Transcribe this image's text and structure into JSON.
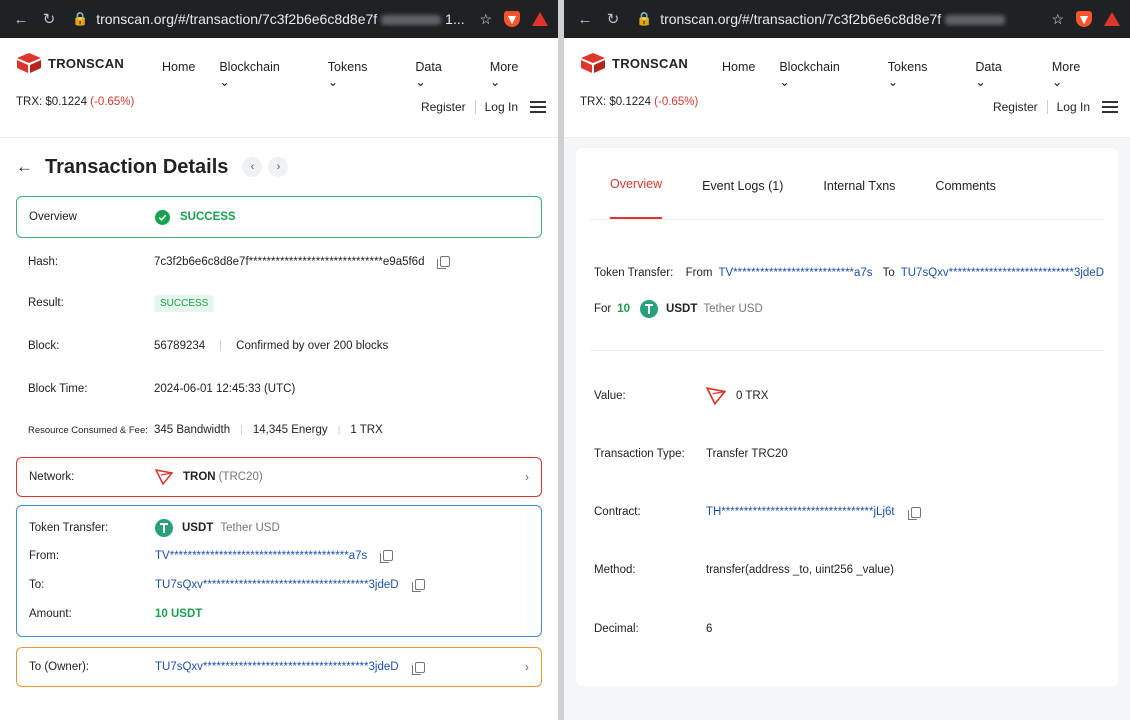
{
  "browser": {
    "url_text": "tronscan.org/#/transaction/7c3f2b6e6c8d8e7f",
    "url_suffix_left": "1..."
  },
  "site": {
    "logo_text": "TRONSCAN",
    "menu": [
      "Home",
      "Blockchain",
      "Tokens",
      "Data",
      "More"
    ],
    "price_label": "TRX: $0.1224",
    "price_change": "(-0.65%)",
    "register": "Register",
    "login": "Log In"
  },
  "left": {
    "title": "Transaction Details",
    "overview_label": "Overview",
    "overview_status": "SUCCESS",
    "hash_label": "Hash:",
    "hash_value": "7c3f2b6e6c8d8e7f******************************e9a5f6d",
    "result_label": "Result:",
    "result_value": "SUCCESS",
    "block_label": "Block:",
    "block_value": "56789234",
    "block_confirm": "Confirmed by over 200 blocks",
    "time_label": "Block Time:",
    "time_value": "2024-06-01 12:45:33 (UTC)",
    "resource_label": "Resource Consumed & Fee:",
    "bandwidth": "345 Bandwidth",
    "energy": "14,345 Energy",
    "fee": "1 TRX",
    "network_label": "Network:",
    "network_value": "TRON",
    "network_std": "(TRC20)",
    "token_transfer_label": "Token Transfer:",
    "token_symbol": "USDT",
    "token_name": "Tether USD",
    "from_label": "From:",
    "from_value": "TV****************************************a7s",
    "to_label": "To:",
    "to_value": "TU7sQxv*************************************3jdeD",
    "amount_label": "Amount:",
    "amount_value": "10 USDT",
    "owner_label": "To (Owner):",
    "owner_value": "TU7sQxv*************************************3jdeD"
  },
  "right": {
    "tabs": [
      "Overview",
      "Event Logs (1)",
      "Internal Txns",
      "Comments"
    ],
    "token_transfer_label": "Token Transfer:",
    "from_word": "From",
    "from_value": "TV***************************a7s",
    "to_word": "To",
    "to_value": "TU7sQxv****************************3jdeD",
    "for_word": "For",
    "for_amount": "10",
    "token_symbol": "USDT",
    "token_name": "Tether USD",
    "value_label": "Value:",
    "value_value": "0 TRX",
    "type_label": "Transaction Type:",
    "type_value": "Transfer TRC20",
    "contract_label": "Contract:",
    "contract_value": "TH**********************************jLj6t",
    "method_label": "Method:",
    "method_value": "transfer(address _to, uint256 _value)",
    "decimal_label": "Decimal:",
    "decimal_value": "6"
  },
  "colors": {
    "accent_red": "#e0352b",
    "success_green": "#14a44d",
    "link_blue": "#1a4fb8",
    "tether_teal": "#26a17b"
  }
}
